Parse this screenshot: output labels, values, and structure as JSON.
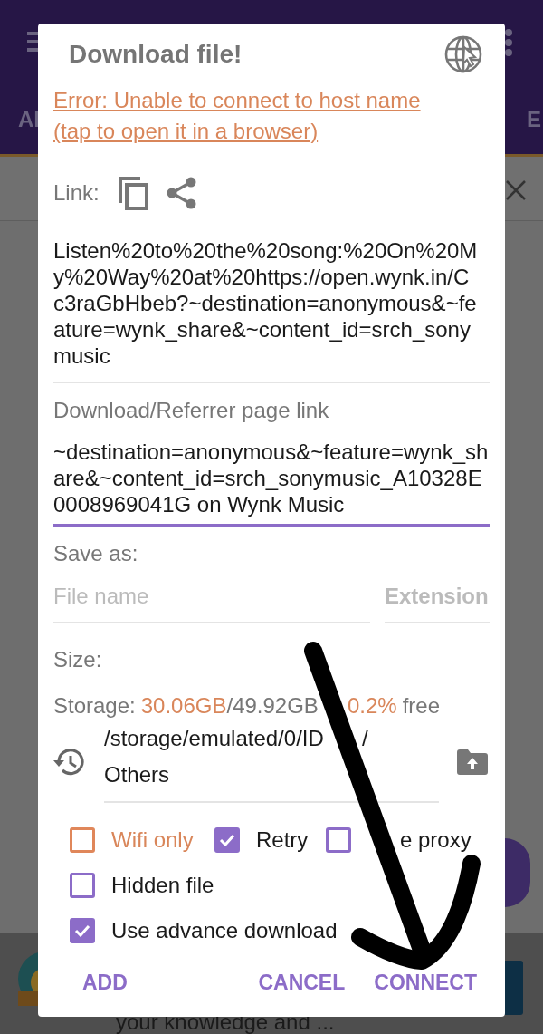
{
  "background": {
    "tab_left": "Al",
    "tab_right": "E",
    "feed_text": "your knowledge and ..."
  },
  "dialog": {
    "title": "Download file!",
    "error": "Error: Unable to connect to host name (tap to open it in a browser)",
    "link_label": "Link:",
    "link_value": "Listen%20to%20the%20song:%20On%20My%20Way%20at%20https://open.wynk.in/Cc3raGbHbeb?~destination=anonymous&~feature=wynk_share&~content_id=srch_sonymusic",
    "referrer": {
      "label": "Download/Referrer page link",
      "value": "~destination=anonymous&~feature=wynk_share&~content_id=srch_sonymusic_A10328E0008969041G on Wynk Music"
    },
    "save_as_label": "Save as:",
    "file_name": {
      "placeholder": "File name"
    },
    "extension": {
      "placeholder": "Extension"
    },
    "size_label": "Size:",
    "storage": {
      "label": "Storage:",
      "used": "30.06GB",
      "total": "/49.92GB",
      "percent": "0.2%",
      "suffix": "free"
    },
    "path": [
      "/storage/emulated/0/ID",
      "/",
      "Others"
    ],
    "options": [
      {
        "label": "Wifi only",
        "checked": false,
        "highlighted": true
      },
      {
        "label": "Retry",
        "checked": true,
        "highlighted": false
      },
      {
        "label": "e proxy",
        "checked": false,
        "highlighted": false
      },
      {
        "label": "Hidden file",
        "checked": false,
        "highlighted": false
      },
      {
        "label": "Use advance download",
        "checked": true,
        "highlighted": false
      }
    ],
    "buttons": [
      {
        "label": "ADD",
        "kind": "left"
      },
      {
        "label": "CANCEL",
        "kind": "right"
      },
      {
        "label": "CONNECT",
        "kind": "right"
      }
    ]
  }
}
